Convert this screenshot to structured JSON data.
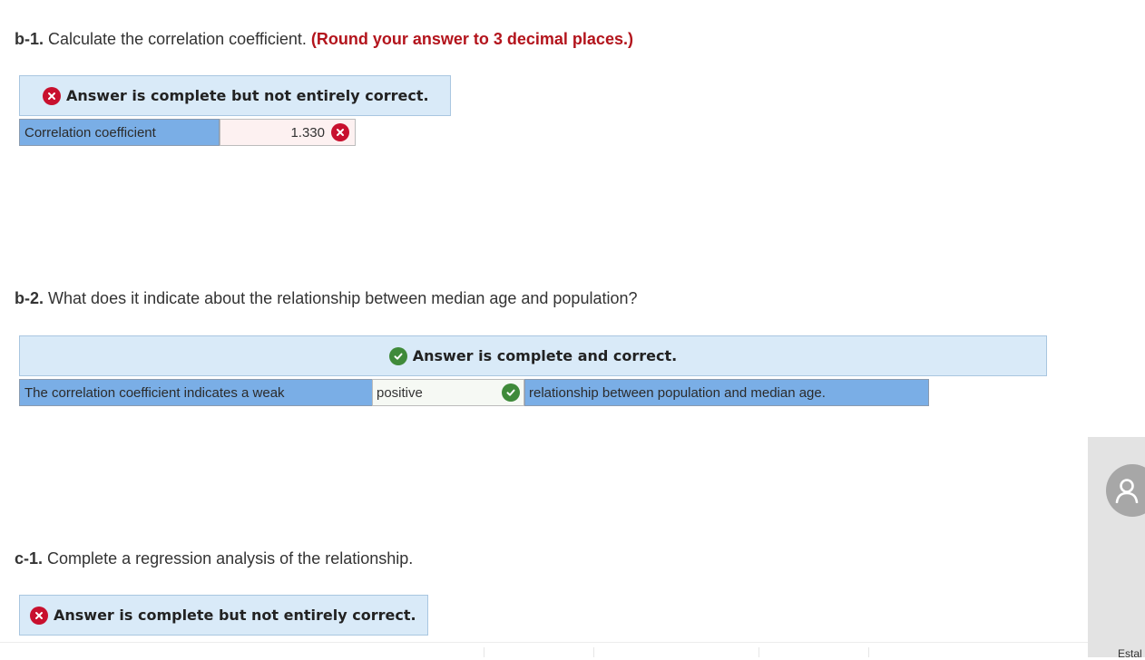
{
  "b1": {
    "number": "b-1.",
    "text": "Calculate the correlation coefficient.",
    "hint": "(Round your answer to 3 decimal places.)",
    "banner": "Answer is complete but not entirely correct.",
    "row": {
      "label": "Correlation coefficient",
      "value": "1.330"
    }
  },
  "b2": {
    "number": "b-2.",
    "text": "What does it indicate about the relationship between median age and population?",
    "banner": "Answer is complete and correct.",
    "row": {
      "prefix": "The correlation coefficient indicates a weak",
      "selected": "positive",
      "suffix": "relationship between population and median age."
    }
  },
  "c1": {
    "number": "c-1.",
    "text": "Complete a regression analysis of the relationship.",
    "banner": "Answer is complete but not entirely correct."
  },
  "side": {
    "partial_text": "Estal"
  },
  "icons": {
    "incorrect": "x-circle-icon",
    "correct": "check-circle-icon",
    "user": "user-icon"
  },
  "colors": {
    "error": "#c8102e",
    "success": "#3f8a3a",
    "hint_red": "#b3141c",
    "banner_bg": "#d9eaf8",
    "label_bg": "#7aaee6"
  }
}
